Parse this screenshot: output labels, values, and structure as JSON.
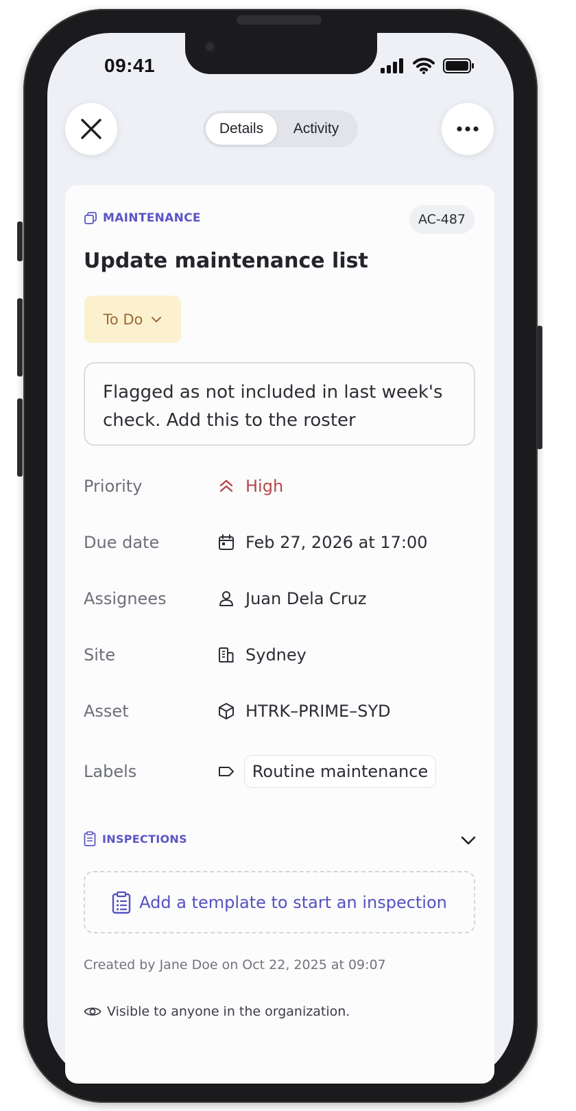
{
  "status_bar": {
    "time": "09:41"
  },
  "header": {
    "close_icon": "close-icon",
    "more_icon": "more-icon",
    "tabs": [
      {
        "label": "Details",
        "active": true
      },
      {
        "label": "Activity",
        "active": false
      }
    ]
  },
  "task": {
    "category": "MAINTENANCE",
    "id": "AC-487",
    "title": "Update maintenance list",
    "status": "To Do",
    "description": "Flagged as not included in last week's check. Add this to the roster"
  },
  "properties": {
    "priority": {
      "label": "Priority",
      "value": "High",
      "icon": "chevrons-up-icon"
    },
    "due_date": {
      "label": "Due date",
      "value": "Feb 27, 2026 at 17:00",
      "icon": "calendar-icon"
    },
    "assignees": {
      "label": "Assignees",
      "value": "Juan Dela Cruz",
      "icon": "user-icon"
    },
    "site": {
      "label": "Site",
      "value": "Sydney",
      "icon": "building-icon"
    },
    "asset": {
      "label": "Asset",
      "value": "HTRK–PRIME–SYD",
      "icon": "cube-icon"
    },
    "labels": {
      "label": "Labels",
      "value": "Routine maintenance",
      "icon": "tag-icon"
    }
  },
  "inspections": {
    "heading": "INSPECTIONS",
    "add_label": "Add a template to start an inspection"
  },
  "footer": {
    "created": "Created by Jane Doe on Oct 22, 2025 at 09:07",
    "visibility": "Visible to anyone in the organization."
  },
  "colors": {
    "accent": "#5b55c5",
    "priority_high": "#b3474b",
    "status_bg": "#fcf1cf",
    "status_text": "#9a6a36"
  }
}
